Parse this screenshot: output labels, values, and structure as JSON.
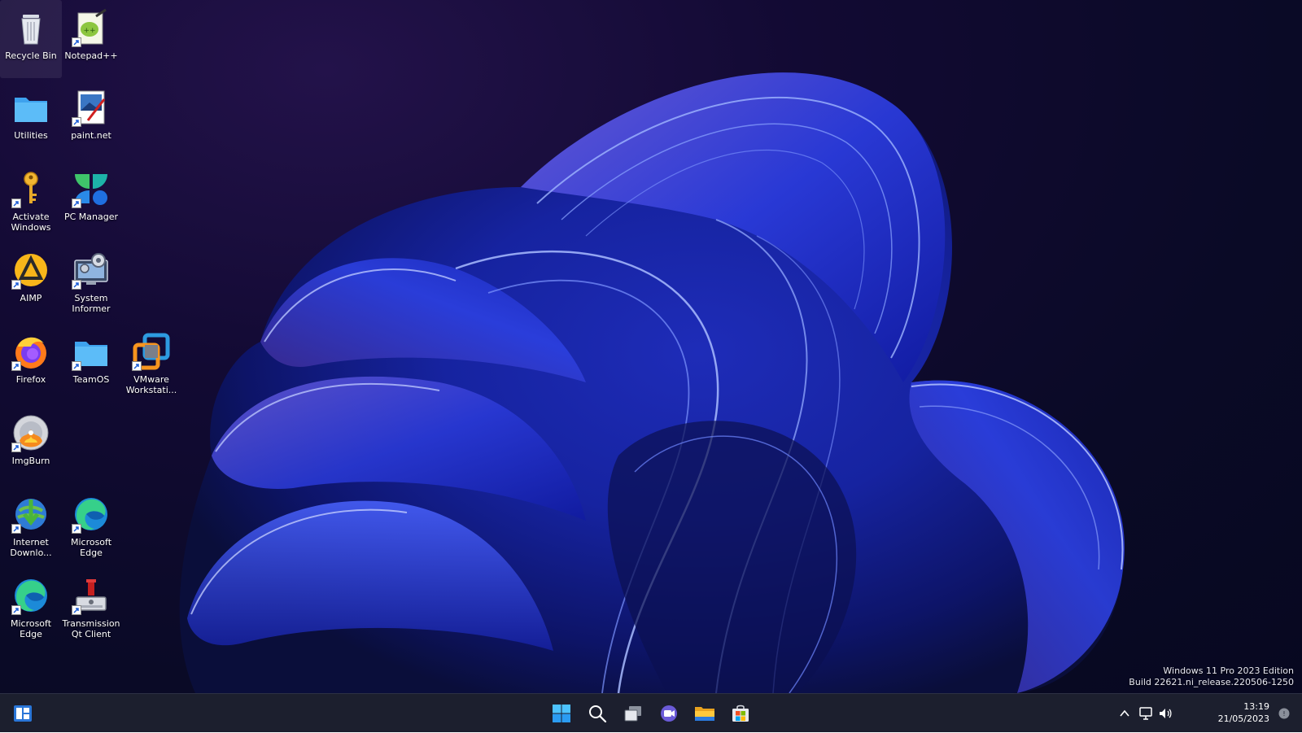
{
  "desktop": {
    "icons": [
      {
        "label": "Recycle Bin",
        "icon": "recycle-bin-icon"
      },
      {
        "label": "Notepad++",
        "icon": "notepadpp-icon"
      },
      {
        "label": "Utilities",
        "icon": "folder-icon"
      },
      {
        "label": "paint.net",
        "icon": "paintnet-icon"
      },
      {
        "label": "Activate\nWindows",
        "icon": "key-icon"
      },
      {
        "label": "PC Manager",
        "icon": "pc-manager-icon"
      },
      {
        "label": "AIMP",
        "icon": "aimp-icon"
      },
      {
        "label": "System\nInformer",
        "icon": "system-informer-icon"
      },
      {
        "label": "Firefox",
        "icon": "firefox-icon"
      },
      {
        "label": "TeamOS",
        "icon": "folder-icon"
      },
      {
        "label": "VMware\nWorkstati...",
        "icon": "vmware-icon"
      },
      {
        "label": "ImgBurn",
        "icon": "imgburn-icon"
      },
      {
        "label": "Internet\nDownlo...",
        "icon": "internet-download-manager-icon"
      },
      {
        "label": "Microsoft\nEdge",
        "icon": "edge-icon"
      },
      {
        "label": "Microsoft\nEdge",
        "icon": "edge-icon"
      },
      {
        "label": "Transmission\nQt Client",
        "icon": "transmission-icon"
      }
    ]
  },
  "watermark": {
    "line1": "Windows 11 Pro 2023 Edition",
    "line2": "Build 22621.ni_release.220506-1250"
  },
  "taskbar": {
    "left_widget": "widgets-icon",
    "center_buttons": [
      "start-icon",
      "search-icon",
      "task-view-icon",
      "chat-icon",
      "file-explorer-icon",
      "microsoft-store-icon"
    ],
    "tray": [
      "chevron-up-icon",
      "network-icon",
      "volume-icon",
      "notification-icon"
    ],
    "clock": {
      "time": "13:19",
      "date": "21/05/2023"
    }
  },
  "colors": {
    "taskbar_bg": "#1c1f2e",
    "wallpaper_dark": "#0a0a26",
    "wallpaper_accent": "#2f4fff",
    "folder_blue": "#4fb4f4"
  }
}
